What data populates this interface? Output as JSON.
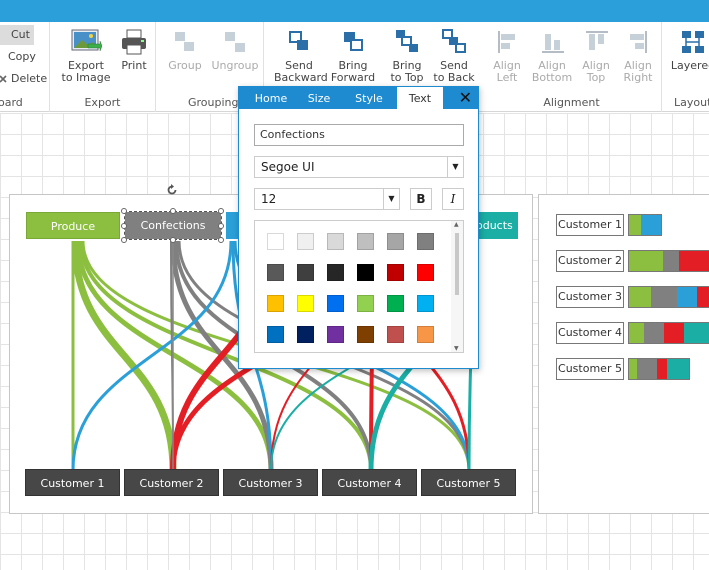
{
  "ribbon": {
    "clipboard": {
      "cut": "Cut",
      "copy": "Copy",
      "delete": "Delete",
      "label": "oard"
    },
    "export": {
      "export_l1": "Export",
      "export_l2": "to Image",
      "print": "Print",
      "label": "Export"
    },
    "grouping": {
      "group": "Group",
      "ungroup": "Ungroup",
      "label": "Grouping"
    },
    "arrange": {
      "send_backward_l1": "Send",
      "send_backward_l2": "Backward",
      "bring_forward_l1": "Bring",
      "bring_forward_l2": "Forward",
      "bring_to_top_l1": "Bring",
      "bring_to_top_l2": "to Top",
      "send_to_back_l1": "Send",
      "send_to_back_l2": "to Back"
    },
    "alignment": {
      "align_left_l1": "Align",
      "align_left_l2": "Left",
      "align_bottom_l1": "Align",
      "align_bottom_l2": "Bottom",
      "align_top_l1": "Align",
      "align_top_l2": "Top",
      "align_right_l1": "Align",
      "align_right_l2": "Right",
      "label": "Alignment"
    },
    "layout": {
      "layered": "Layered",
      "label": "Layout"
    }
  },
  "diagram": {
    "sources": [
      "Produce",
      "Confections",
      "oducts"
    ],
    "customers": [
      "Customer 1",
      "Customer 2",
      "Customer 3",
      "Customer 4",
      "Customer 5"
    ],
    "colors": {
      "produce": "#8cbf3f",
      "confections": "#808080",
      "blue": "#2a9fd8",
      "red": "#e31e24",
      "teal": "#1aaea4"
    }
  },
  "side_panel": {
    "rows": [
      {
        "label": "Customer 1",
        "segments": [
          {
            "color": "#8cbf3f",
            "w": 12
          },
          {
            "color": "#2a9fd8",
            "w": 20
          }
        ]
      },
      {
        "label": "Customer 2",
        "segments": [
          {
            "color": "#8cbf3f",
            "w": 34
          },
          {
            "color": "#808080",
            "w": 16
          },
          {
            "color": "#e31e24",
            "w": 30
          }
        ]
      },
      {
        "label": "Customer 3",
        "segments": [
          {
            "color": "#8cbf3f",
            "w": 22
          },
          {
            "color": "#808080",
            "w": 26
          },
          {
            "color": "#2a9fd8",
            "w": 20
          },
          {
            "color": "#e31e24",
            "w": 12
          }
        ]
      },
      {
        "label": "Customer 4",
        "segments": [
          {
            "color": "#8cbf3f",
            "w": 15
          },
          {
            "color": "#808080",
            "w": 20
          },
          {
            "color": "#e31e24",
            "w": 20
          },
          {
            "color": "#1aaea4",
            "w": 25
          }
        ]
      },
      {
        "label": "Customer 5",
        "segments": [
          {
            "color": "#8cbf3f",
            "w": 8
          },
          {
            "color": "#808080",
            "w": 20
          },
          {
            "color": "#e31e24",
            "w": 10
          },
          {
            "color": "#1aaea4",
            "w": 22
          }
        ]
      }
    ]
  },
  "popup": {
    "tabs": [
      "Home",
      "Size",
      "Style",
      "Text"
    ],
    "active_tab": "Text",
    "text_value": "Confections",
    "font_family": "Segoe UI",
    "font_size": "12",
    "bold_label": "B",
    "italic_label": "I",
    "swatches": [
      "#ffffff",
      "#f0f0f0",
      "#d9d9d9",
      "#bfbfbf",
      "#a6a6a6",
      "#808080",
      "#595959",
      "#3f3f3f",
      "#262626",
      "#000000",
      "#c00000",
      "#ff0000",
      "#ffc000",
      "#ffff00",
      "#0070f0",
      "#92d050",
      "#00b050",
      "#00b0f0",
      "#0070c0",
      "#002060",
      "#7030a0",
      "#7f3f00",
      "#c0504d",
      "#f79646"
    ]
  }
}
